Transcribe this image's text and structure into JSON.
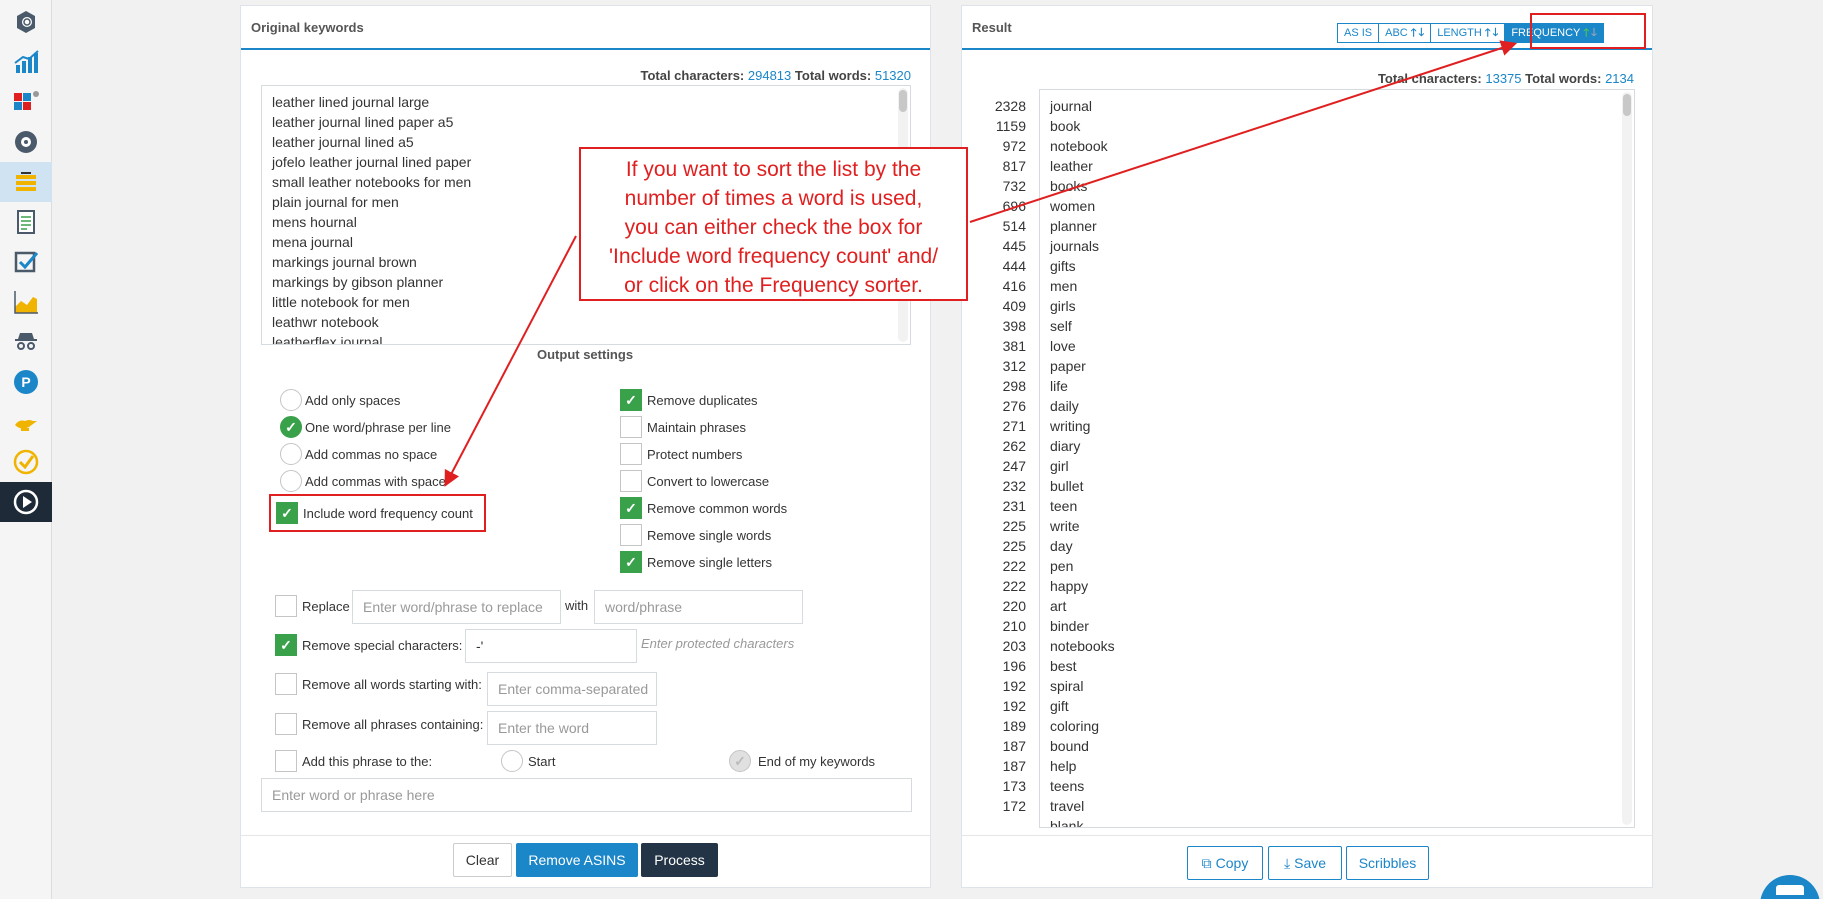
{
  "sidebar": {
    "items": [
      {
        "icon": "cube-search-icon"
      },
      {
        "icon": "bar-chart-icon"
      },
      {
        "icon": "grid-blocks-icon"
      },
      {
        "icon": "brain-gear-icon"
      },
      {
        "icon": "keyword-cleaner-icon"
      },
      {
        "icon": "document-list-icon"
      },
      {
        "icon": "checkbox-icon"
      },
      {
        "icon": "area-chart-icon"
      },
      {
        "icon": "spy-icon"
      },
      {
        "icon": "parking-p-icon"
      },
      {
        "icon": "genie-lamp-icon"
      },
      {
        "icon": "check-circle-icon"
      },
      {
        "icon": "play-icon"
      }
    ]
  },
  "left": {
    "title": "Original keywords",
    "totals": {
      "chars_label": "Total characters:",
      "chars": "294813",
      "words_label": "Total words:",
      "words": "51320"
    },
    "keywords": [
      "leather lined journal large",
      "leather journal lined paper a5",
      "leather journal lined a5",
      "jofelo leather journal lined paper",
      "small leather notebooks for men",
      "plain journal for men",
      "mens hournal",
      "mena journal",
      "markings journal brown",
      "markings by gibson planner",
      "little notebook for men",
      "leathwr notebook",
      "leatherflex journal"
    ],
    "output_settings": "Output settings",
    "radios": [
      {
        "label": "Add only spaces",
        "on": false
      },
      {
        "label": "One word/phrase per line",
        "on": true
      },
      {
        "label": "Add commas no space",
        "on": false
      },
      {
        "label": "Add commas with space",
        "on": false
      }
    ],
    "freq_count_label": "Include word frequency count",
    "checks": [
      {
        "label": "Remove duplicates",
        "on": true
      },
      {
        "label": "Maintain phrases",
        "on": false
      },
      {
        "label": "Protect numbers",
        "on": false
      },
      {
        "label": "Convert to lowercase",
        "on": false
      },
      {
        "label": "Remove common words",
        "on": true
      },
      {
        "label": "Remove single words",
        "on": false
      },
      {
        "label": "Remove single letters",
        "on": true
      }
    ],
    "replace_label": "Replace",
    "replace_placeholder": "Enter word/phrase to replace",
    "with_label": "with",
    "with_placeholder": "word/phrase",
    "special_label": "Remove special characters:",
    "special_value": "-'",
    "special_hint": "Enter protected characters",
    "starting_label": "Remove all words starting with:",
    "starting_placeholder": "Enter comma-separated",
    "containing_label": "Remove all phrases containing:",
    "containing_placeholder": "Enter the word",
    "add_phrase_label": "Add this phrase to the:",
    "start_label": "Start",
    "end_label": "End of my keywords",
    "phrase_placeholder": "Enter word or phrase here",
    "buttons": {
      "clear": "Clear",
      "remove_asins": "Remove ASINS",
      "process": "Process"
    }
  },
  "right": {
    "title": "Result",
    "sorters": [
      {
        "label": "AS IS"
      },
      {
        "label": "ABC"
      },
      {
        "label": "LENGTH"
      },
      {
        "label": "FREQUENCY"
      }
    ],
    "totals": {
      "chars_label": "Total characters:",
      "chars": "13375",
      "words_label": "Total words:",
      "words": "2134"
    },
    "results": [
      [
        "2328",
        "journal"
      ],
      [
        "1159",
        "book"
      ],
      [
        "972",
        "notebook"
      ],
      [
        "817",
        "leather"
      ],
      [
        "732",
        "books"
      ],
      [
        "696",
        "women"
      ],
      [
        "514",
        "planner"
      ],
      [
        "445",
        "journals"
      ],
      [
        "444",
        "gifts"
      ],
      [
        "416",
        "men"
      ],
      [
        "409",
        "girls"
      ],
      [
        "398",
        "self"
      ],
      [
        "381",
        "love"
      ],
      [
        "312",
        "paper"
      ],
      [
        "298",
        "life"
      ],
      [
        "276",
        "daily"
      ],
      [
        "271",
        "writing"
      ],
      [
        "262",
        "diary"
      ],
      [
        "247",
        "girl"
      ],
      [
        "232",
        "bullet"
      ],
      [
        "231",
        "teen"
      ],
      [
        "225",
        "write"
      ],
      [
        "225",
        "day"
      ],
      [
        "222",
        "pen"
      ],
      [
        "222",
        "happy"
      ],
      [
        "220",
        "art"
      ],
      [
        "210",
        "binder"
      ],
      [
        "203",
        "notebooks"
      ],
      [
        "196",
        "best"
      ],
      [
        "192",
        "spiral"
      ],
      [
        "192",
        "gift"
      ],
      [
        "189",
        "coloring"
      ],
      [
        "187",
        "bound"
      ],
      [
        "187",
        "help"
      ],
      [
        "173",
        "teens"
      ],
      [
        "172",
        "travel"
      ],
      [
        "",
        "blank"
      ]
    ],
    "buttons": {
      "copy": "Copy",
      "save": "Save",
      "scribbles": "Scribbles"
    }
  },
  "callout": {
    "lines": [
      "If you want to sort the list by the",
      "number of times a word is used,",
      "you can either check the box for",
      "'Include word frequency count' and/",
      "or click on the Frequency sorter."
    ]
  },
  "colors": {
    "accent": "#1b86c8",
    "green": "#3aa14b",
    "annotation": "#e02020",
    "navy": "#233446"
  }
}
